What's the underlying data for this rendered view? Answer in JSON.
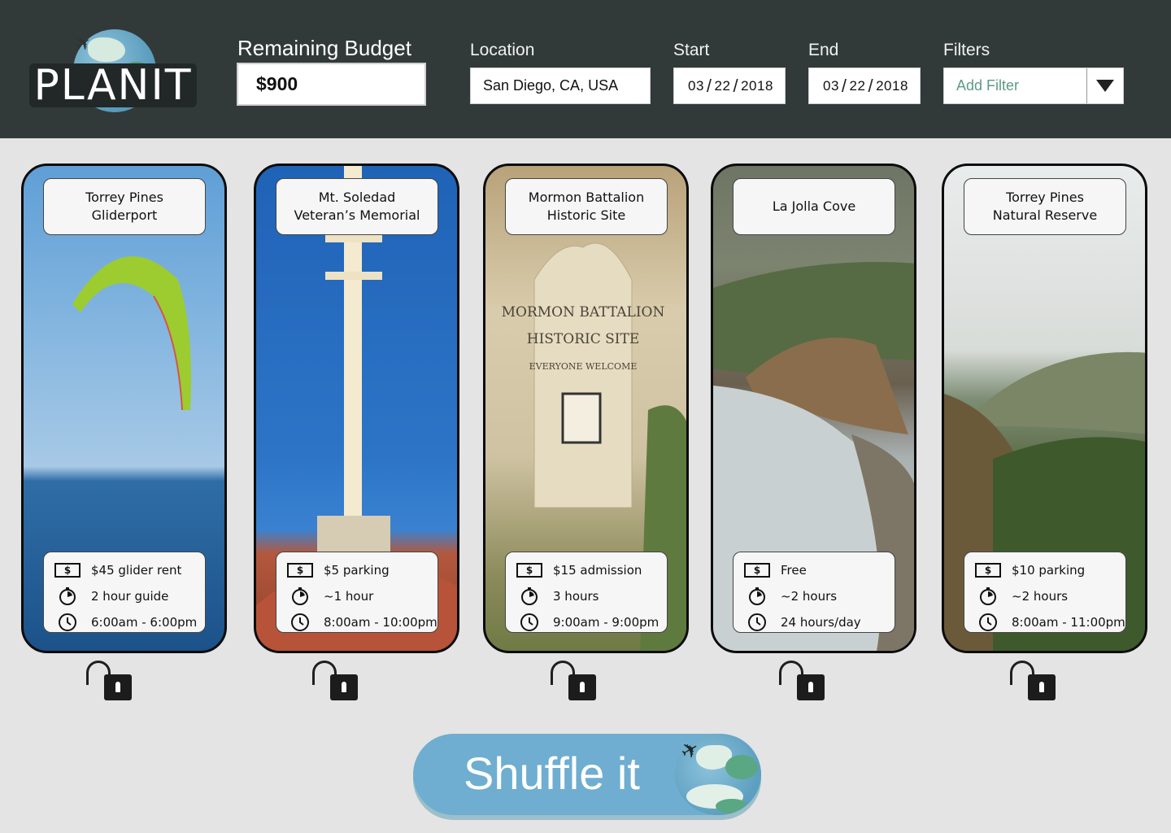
{
  "app": {
    "logo_text": "PLANIT"
  },
  "header": {
    "budget_label": "Remaining Budget",
    "budget_value": "$900",
    "location_label": "Location",
    "location_value": "San Diego, CA, USA",
    "start_label": "Start",
    "start_date": {
      "month": "03",
      "day": "22",
      "year": "2018"
    },
    "end_label": "End",
    "end_date": {
      "month": "03",
      "day": "22",
      "year": "2018"
    },
    "filters_label": "Filters",
    "filters_placeholder": "Add Filter"
  },
  "colors": {
    "header_bg": "#313a39",
    "page_bg": "#e4e4e4",
    "shuffle_bg": "#6faed0",
    "filter_text": "#5d9a88"
  },
  "cards": [
    {
      "title": "Torrey Pines\nGliderport",
      "cost": "$45 glider rent",
      "duration": "2 hour guide",
      "hours": "6:00am - 6:00pm",
      "photo": "paraglider-over-ocean",
      "locked": false
    },
    {
      "title": "Mt. Soledad\nVeteran’s Memorial",
      "cost": "$5 parking",
      "duration": "~1 hour",
      "hours": "8:00am - 10:00pm",
      "photo": "cross-memorial",
      "locked": false
    },
    {
      "title": "Mormon Battalion\nHistoric Site",
      "cost": "$15 admission",
      "duration": "3 hours",
      "hours": "9:00am - 9:00pm",
      "photo": "historic-site-sign",
      "locked": false
    },
    {
      "title": "La Jolla Cove",
      "cost": "Free",
      "duration": "~2 hours",
      "hours": "24 hours/day",
      "photo": "rocky-cove",
      "locked": false
    },
    {
      "title": "Torrey Pines\nNatural Reserve",
      "cost": "$10 parking",
      "duration": "~2 hours",
      "hours": "8:00am - 11:00pm",
      "photo": "coastal-reserve",
      "locked": false
    }
  ],
  "icons": {
    "cost": "money-icon",
    "duration": "stopwatch-icon",
    "hours": "clock-icon",
    "lock": "unlocked-padlock-icon"
  },
  "shuffle": {
    "label": "Shuffle it"
  }
}
